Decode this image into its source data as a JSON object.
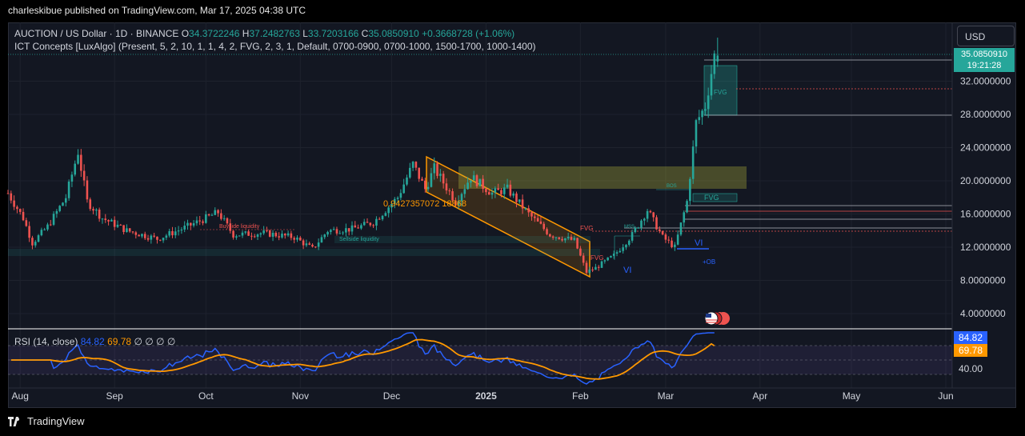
{
  "publisher": "charleskibue published on TradingView.com, Mar 17, 2025 04:38 UTC",
  "legend": {
    "symbol": "AUCTION / US Dollar · 1D · BINANCE",
    "o_label": "O",
    "o": "34.3722246",
    "h_label": "H",
    "h": "37.2482763",
    "l_label": "L",
    "l": "33.7203166",
    "c_label": "C",
    "c": "35.0850910",
    "change": "+0.3668728 (+1.06%)"
  },
  "indicator": "ICT Concepts [LuxAlgo] (Present, 5, 2, 10, 1, 1, 4, 2, FVG, 2, 3, 1, Default, 0700-0900, 0700-1000, 1500-1700, 1000-1400)",
  "currency_button": "USD",
  "price_tag": {
    "price": "35.0850910",
    "countdown": "19:21:28"
  },
  "annotations": {
    "fvg": "FVG",
    "bos": "BOS",
    "mss": "MSS",
    "vi": "VI",
    "ob": "+OB",
    "buyside": "Buyside liquidity",
    "sellside": "Sellside liquidity",
    "channel_label": "0.9427357072 18868"
  },
  "rsi_legend": {
    "name": "RSI (14, close)",
    "rsi": "84.82",
    "ma": "69.78",
    "z1": "∅",
    "z2": "∅",
    "z3": "∅",
    "z4": "∅"
  },
  "rsi_tags": {
    "rsi": "84.82",
    "ma": "69.78",
    "level": "40.00"
  },
  "footer": {
    "brand": "TradingView"
  },
  "colors": {
    "up": "#26a69a",
    "down": "#ef5350",
    "bg": "#131722",
    "rsi": "#2962ff",
    "rsi_ma": "#ff9800",
    "channel": "#ff9800"
  },
  "chart_data": [
    {
      "type": "candlestick",
      "title": "AUCTION / US Dollar · 1D · BINANCE",
      "x_ticks": [
        "Aug",
        "Sep",
        "Oct",
        "Nov",
        "Dec",
        "2025",
        "Feb",
        "Mar",
        "Apr",
        "May",
        "Jun"
      ],
      "y_ticks": [
        "4.0000000",
        "8.0000000",
        "12.0000000",
        "16.0000000",
        "20.0000000",
        "24.0000000",
        "28.0000000",
        "32.0000000"
      ],
      "ylim": [
        1,
        38
      ],
      "close_path_points": [
        [
          "2024-07-28",
          18.5
        ],
        [
          "2024-08-02",
          15.5
        ],
        [
          "2024-08-05",
          12.5
        ],
        [
          "2024-08-10",
          14.5
        ],
        [
          "2024-08-16",
          18.0
        ],
        [
          "2024-08-20",
          23.5
        ],
        [
          "2024-08-23",
          17.5
        ],
        [
          "2024-08-28",
          15.5
        ],
        [
          "2024-09-05",
          14.0
        ],
        [
          "2024-09-15",
          13.0
        ],
        [
          "2024-09-25",
          14.5
        ],
        [
          "2024-10-01",
          15.5
        ],
        [
          "2024-10-05",
          16.2
        ],
        [
          "2024-10-10",
          13.5
        ],
        [
          "2024-10-20",
          13.7
        ],
        [
          "2024-10-30",
          13.2
        ],
        [
          "2024-11-05",
          11.8
        ],
        [
          "2024-11-10",
          14.0
        ],
        [
          "2024-11-18",
          14.2
        ],
        [
          "2024-11-25",
          15.0
        ],
        [
          "2024-12-03",
          18.0
        ],
        [
          "2024-12-08",
          22.0
        ],
        [
          "2024-12-12",
          19.0
        ],
        [
          "2024-12-15",
          21.5
        ],
        [
          "2024-12-22",
          17.5
        ],
        [
          "2024-12-27",
          20.5
        ],
        [
          "2025-01-03",
          18.5
        ],
        [
          "2025-01-08",
          19.0
        ],
        [
          "2025-01-15",
          16.0
        ],
        [
          "2025-01-22",
          13.5
        ],
        [
          "2025-01-30",
          12.8
        ],
        [
          "2025-02-03",
          9.0
        ],
        [
          "2025-02-06",
          9.5
        ],
        [
          "2025-02-12",
          11.0
        ],
        [
          "2025-02-18",
          13.5
        ],
        [
          "2025-02-23",
          16.5
        ],
        [
          "2025-02-28",
          13.2
        ],
        [
          "2025-03-04",
          12.0
        ],
        [
          "2025-03-08",
          17.5
        ],
        [
          "2025-03-11",
          27.0
        ],
        [
          "2025-03-14",
          29.0
        ],
        [
          "2025-03-17",
          35.085091
        ]
      ]
    },
    {
      "type": "line",
      "title": "RSI (14, close)",
      "series": [
        {
          "name": "RSI",
          "last": 84.82
        },
        {
          "name": "MA",
          "last": 69.78
        }
      ],
      "y_ticks": [
        "40.00"
      ]
    }
  ]
}
